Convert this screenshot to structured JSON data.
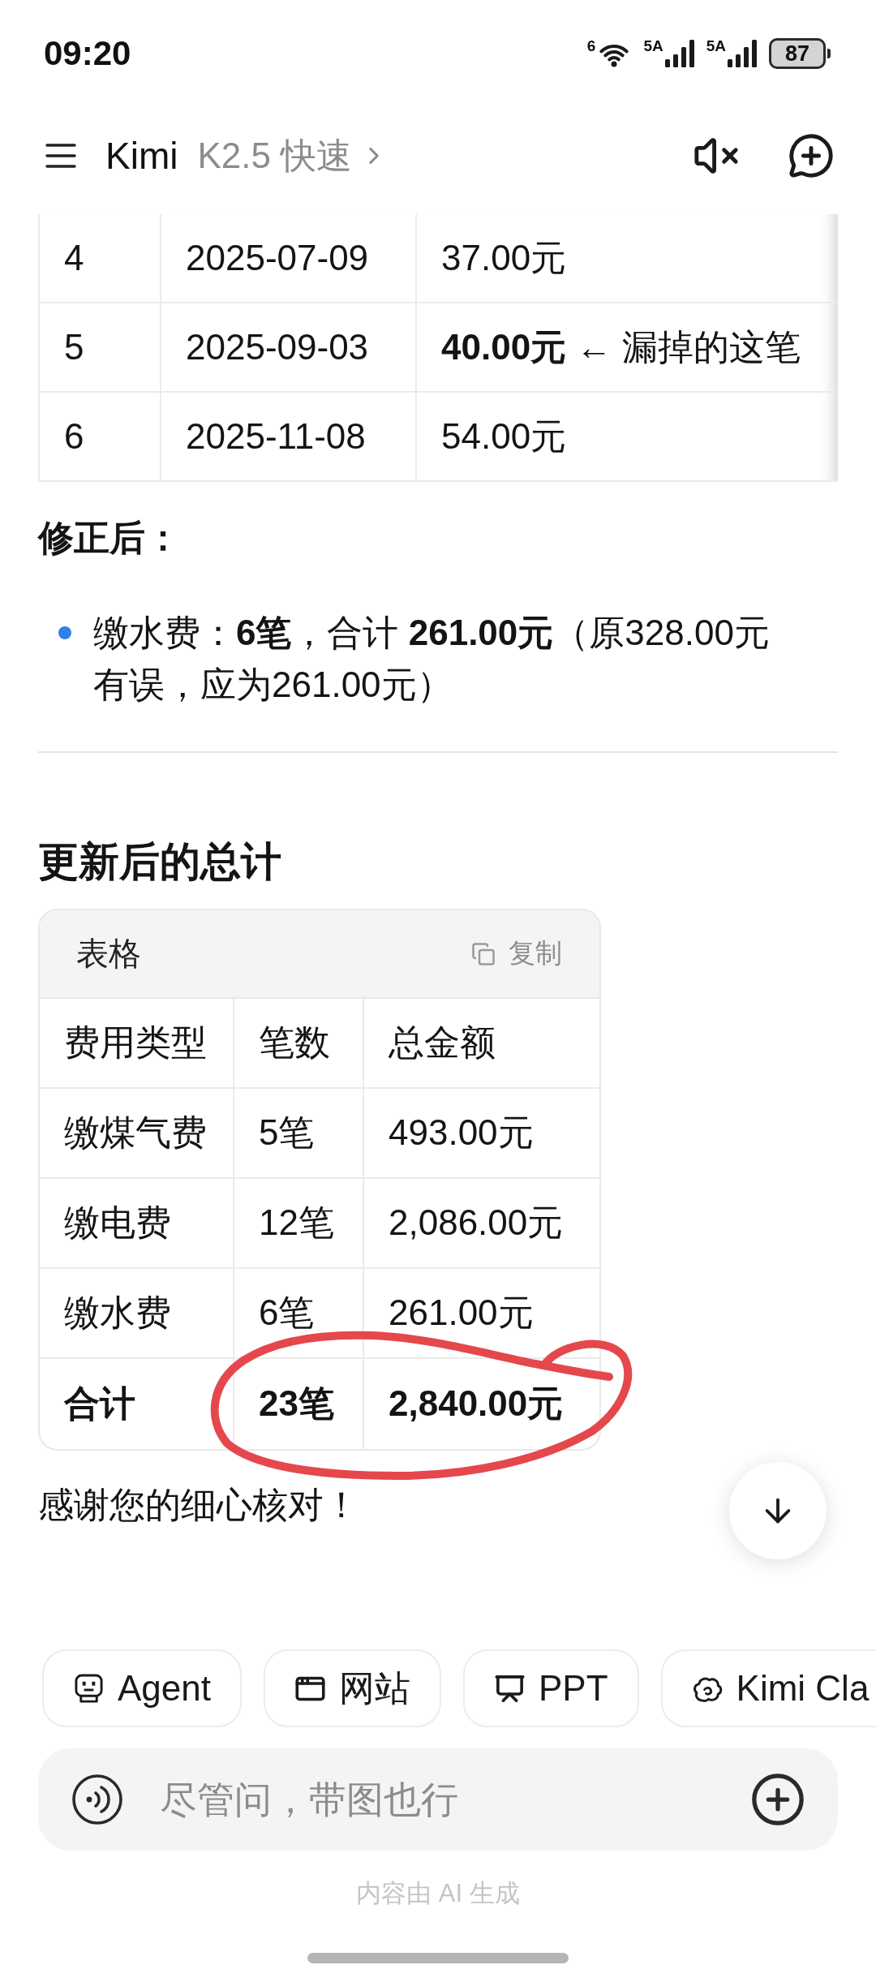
{
  "status_bar": {
    "time": "09:20",
    "wifi_label": "6",
    "network_labels": [
      "5A",
      "5A"
    ],
    "battery": "87"
  },
  "header": {
    "title": "Kimi",
    "model": "K2.5 快速"
  },
  "previous_table": {
    "rows": [
      {
        "cells": [
          "4",
          "2025-07-09",
          "37.00元"
        ]
      },
      {
        "cells": [
          "5",
          "2025-09-03",
          "**40.00元** ← 漏掉的这笔"
        ]
      },
      {
        "cells": [
          "6",
          "2025-11-08",
          "54.00元"
        ]
      }
    ]
  },
  "correction": {
    "heading": "修正后：",
    "bullets": [
      "缴水费：**6笔**，合计 **261.00元**（原328.00元有误，应为261.00元）"
    ]
  },
  "totals": {
    "heading": "更新后的总计",
    "table": {
      "title": "表格",
      "copy_label": "复制",
      "columns": [
        "费用类型",
        "笔数",
        "总金额"
      ],
      "rows": [
        {
          "kind": "data",
          "cells": [
            "缴煤气费",
            "5笔",
            "493.00元"
          ]
        },
        {
          "kind": "data",
          "cells": [
            "缴电费",
            "12笔",
            "2,086.00元"
          ]
        },
        {
          "kind": "data",
          "cells": [
            "缴水费",
            "6笔",
            "261.00元"
          ]
        },
        {
          "kind": "total",
          "cells": [
            "合计",
            "23笔",
            "2,840.00元"
          ]
        }
      ]
    }
  },
  "closing": "感谢您的细心核对！",
  "shortcuts": [
    {
      "label": "Agent"
    },
    {
      "label": "网站"
    },
    {
      "label": "PPT"
    },
    {
      "label": "Kimi Cla"
    }
  ],
  "composer": {
    "placeholder": "尽管问，带图也行"
  },
  "disclaimer": "内容由 AI 生成"
}
